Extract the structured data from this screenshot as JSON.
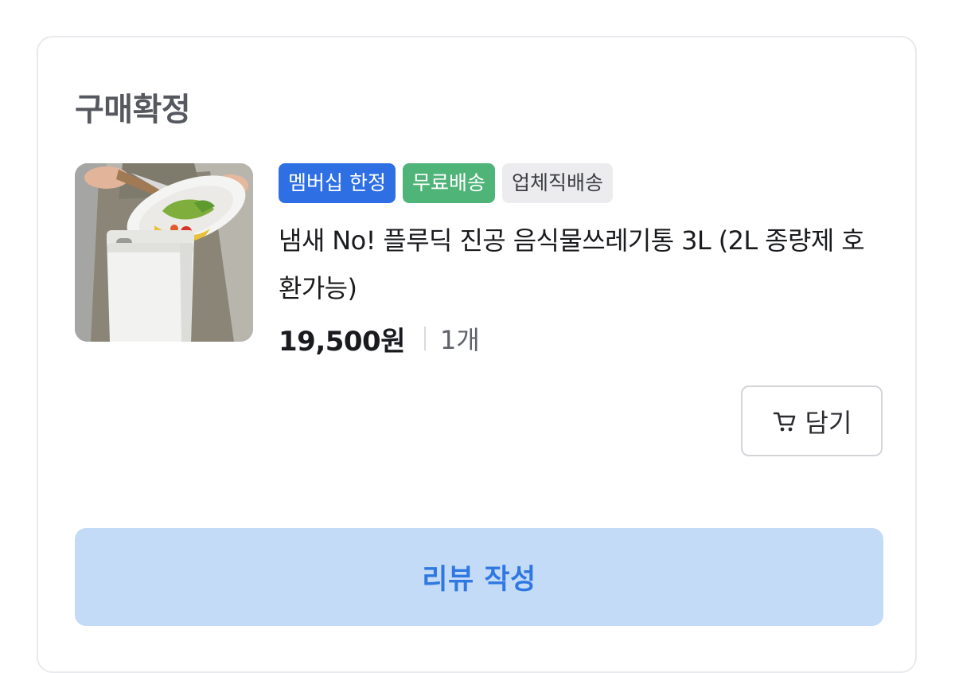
{
  "order": {
    "status": "구매확정"
  },
  "product": {
    "badges": {
      "membership": "멤버십 한정",
      "free_shipping": "무료배송",
      "direct_shipping": "업체직배송"
    },
    "name": "냄새 No! 플루딕 진공 음식물쓰레기통 3L (2L 종량제 호환가능)",
    "price": "19,500원",
    "quantity": "1개",
    "image_icon": "product-photo-food-waste-bin"
  },
  "actions": {
    "cart_label": "담기",
    "cart_icon": "cart-icon",
    "review_label": "리뷰 작성"
  },
  "colors": {
    "membership_badge": "#2e6fe4",
    "free_shipping_badge": "#4fb478",
    "direct_shipping_badge": "#ececee",
    "review_button_bg": "#c4dbf8",
    "review_button_text": "#2f78e2"
  }
}
